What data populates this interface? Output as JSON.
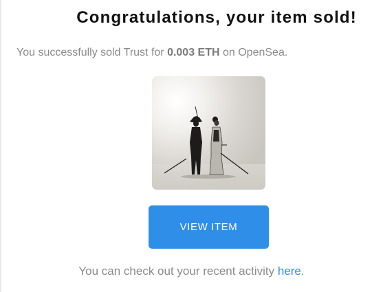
{
  "email": {
    "headline": "Congratulations, your item sold!",
    "sale_prefix": "You successfully sold Trust for ",
    "price": "0.003 ETH",
    "sale_suffix": " on OpenSea.",
    "image": {
      "alt_icon": "nft-artwork-image"
    },
    "button_label": "VIEW ITEM",
    "footer_prefix": "You can check out your recent activity ",
    "footer_link": "here",
    "footer_suffix": "."
  },
  "colors": {
    "accent": "#2f8fe8",
    "headline": "#111111",
    "body_text": "#8a8a8a"
  }
}
